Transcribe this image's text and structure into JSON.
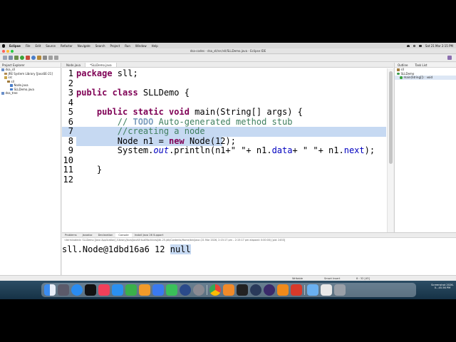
{
  "menubar": {
    "items": [
      "Eclipse",
      "File",
      "Edit",
      "Source",
      "Refactor",
      "Navigate",
      "Search",
      "Project",
      "Run",
      "Window",
      "Help"
    ],
    "clock": "Sat 21 Mar 2:15 PM"
  },
  "window": {
    "title": "dsa-codes - dsa_sll/src/sll/SLLDemo.java - Eclipse IDE"
  },
  "explorer": {
    "tab_label": "Project Explorer",
    "tree": [
      "dsa_sll",
      "JRE System Library [JavaSE-21]",
      "src",
      "sll",
      "Node.java",
      "SLLDemo.java",
      "dsa_tree"
    ]
  },
  "editor": {
    "tabs": [
      "Node.java",
      "*SLLDemo.java"
    ],
    "lines": [
      {
        "num": "1",
        "text": "package sll;"
      },
      {
        "num": "2",
        "text": ""
      },
      {
        "num": "3",
        "text": "public class SLLDemo {"
      },
      {
        "num": "4",
        "text": ""
      },
      {
        "num": "5",
        "text": "    public static void main(String[] args) {"
      },
      {
        "num": "6",
        "text": "        // TODO Auto-generated method stub"
      },
      {
        "num": "7",
        "text": "        //creating a node"
      },
      {
        "num": "8",
        "text": "        Node n1 = new Node(12);"
      },
      {
        "num": "9",
        "text": "        System.out.println(n1+\" \"+ n1.data+ \" \"+ n1.next);"
      },
      {
        "num": "10",
        "text": ""
      },
      {
        "num": "11",
        "text": "    }"
      },
      {
        "num": "12",
        "text": ""
      }
    ]
  },
  "outline": {
    "tabs": [
      "Outline",
      "Task List"
    ],
    "items": [
      "sll",
      "SLLDemo",
      "main(String[]) : void"
    ]
  },
  "console": {
    "tabs": [
      "Problems",
      "Javadoc",
      "Declaration",
      "Console",
      "Install Java 26 Support"
    ],
    "description": "<terminated> SLLDemo [Java Application] /Library/Java/JavaVirtualMachines/jdk-25.jdk/Contents/Home/bin/java (21 Mar 2026, 2:15:17 pm – 2:15:17 pm elapsed: 0:00:00) [pid: 2453]",
    "output_prefix": "sll.Node@1dbd16a6 12 ",
    "output_selected": "null"
  },
  "statusbar": {
    "mode": "Writable",
    "insert": "Smart Insert",
    "position": "8 : 32 [43]"
  },
  "dock": {
    "screenshot_label": "Screenshot 2026-0...45.56 PM"
  }
}
